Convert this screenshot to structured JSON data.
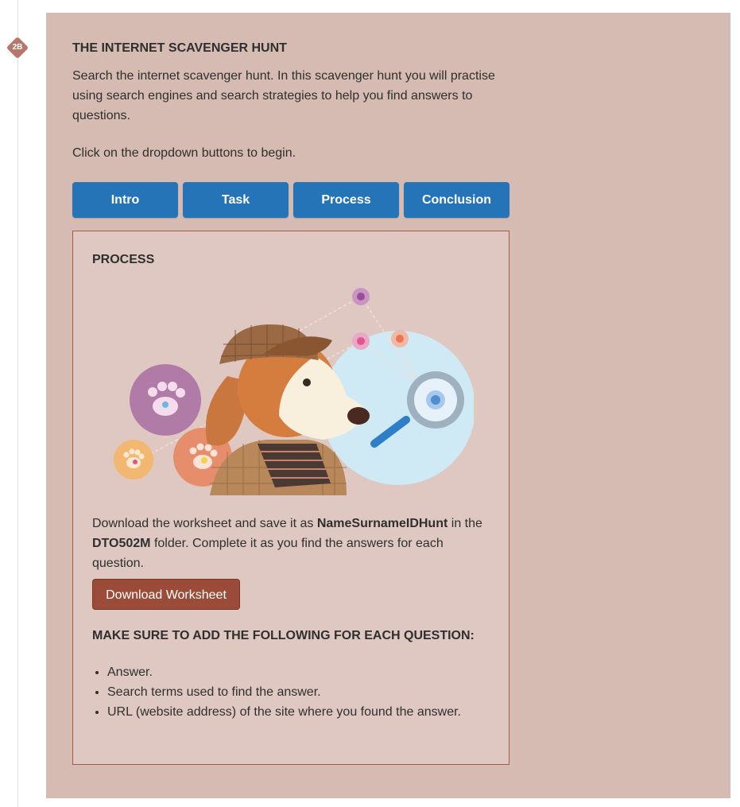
{
  "step": {
    "number": "2B"
  },
  "card": {
    "title": "THE INTERNET SCAVENGER HUNT",
    "intro": "Search the internet scavenger hunt. In this scavenger hunt you will practise using search engines and search strategies to help you find answers to questions.",
    "instruction": "Click on the dropdown buttons to begin."
  },
  "tabs": [
    {
      "label": "Intro"
    },
    {
      "label": "Task"
    },
    {
      "label": "Process"
    },
    {
      "label": "Conclusion"
    }
  ],
  "panel": {
    "title": "PROCESS",
    "body_prefix": "Download the worksheet and save it as ",
    "file_name": "NameSurnameIDHunt",
    "body_middle": " in the ",
    "folder_name": "DTO502M",
    "body_suffix": " folder. Complete it as you find the answers for each question.",
    "download_button": "Download Worksheet",
    "checklist_heading": "MAKE SURE TO ADD THE FOLLOWING FOR EACH QUESTION:",
    "checklist": [
      "Answer.",
      "Search terms used to find the answer.",
      "URL (website address) of the site where you found the answer."
    ]
  },
  "icons": {
    "step_badge": "diamond-badge-icon",
    "illustration": "detective-dog-illustration"
  },
  "colors": {
    "card_bg": "#d5bbb2",
    "panel_bg": "#dec8c1",
    "panel_border": "#a45a47",
    "tab_button": "#2574b8",
    "download_button": "#9a4c38",
    "badge": "#b7776a"
  }
}
